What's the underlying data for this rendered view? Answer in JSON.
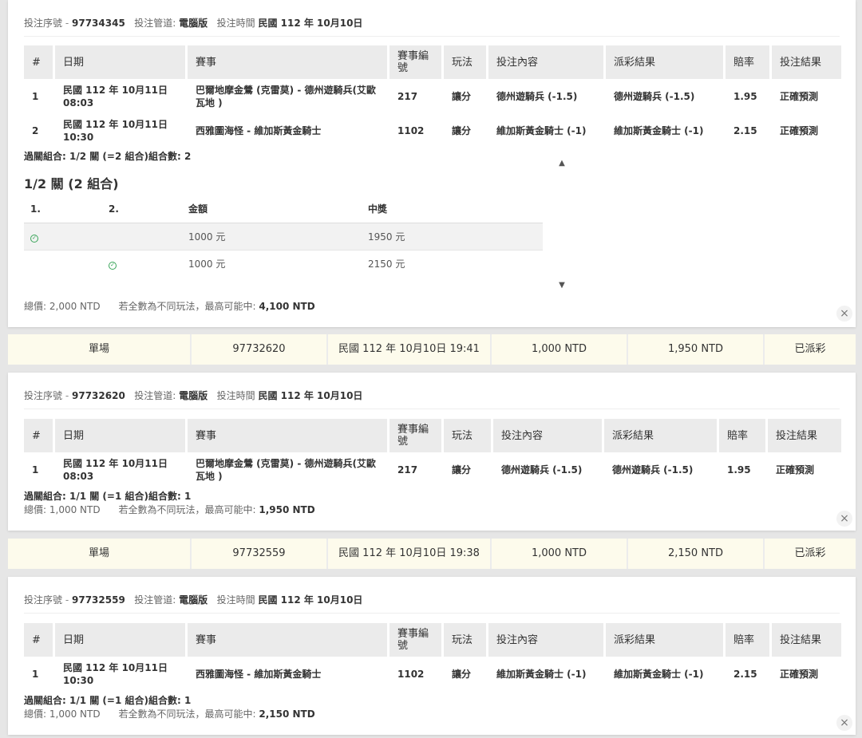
{
  "labels": {
    "serial": "投注序號",
    "channel": "投注管道:",
    "time": "投注時間",
    "total_prefix": "總價:",
    "max_prefix": "若全數為不同玩法，最高可能中:",
    "close_icon": "close-icon",
    "check_icon": "check-circle-icon",
    "scroll_up_icon": "chevron-up-icon",
    "scroll_down_icon": "chevron-down-icon"
  },
  "headers": [
    "#",
    "日期",
    "賽事",
    "賽事編號",
    "玩法",
    "投注內容",
    "派彩結果",
    "賠率",
    "投注結果"
  ],
  "bets": [
    {
      "serial": "97734345",
      "channel": "電腦版",
      "time": "民國 112 年 10月10日",
      "rows": [
        {
          "no": "1",
          "date": "民國 112 年 10月11日",
          "clock": "08:03",
          "game": "巴爾地摩金鶯 (克雷莫) - 德州遊騎兵(艾歐瓦地 )",
          "code": "217",
          "type": "讓分",
          "pick": "德州遊騎兵 (-1.5)",
          "result": "德州遊騎兵 (-1.5)",
          "odds": "1.95",
          "outcome": "正確預測"
        },
        {
          "no": "2",
          "date": "民國 112 年 10月11日",
          "clock": "10:30",
          "game": "西雅圖海怪 - 維加斯黃金騎士",
          "code": "1102",
          "type": "讓分",
          "pick": "維加斯黃金騎士 (-1)",
          "result": "維加斯黃金騎士 (-1)",
          "odds": "2.15",
          "outcome": "正確預測"
        }
      ],
      "combo": "過關組合: 1/2 關 (=2 組合)組合數: 2",
      "combo_detail": {
        "title": "1/2 關 (2 組合)",
        "headers": [
          "1.",
          "2.",
          "金額",
          "中獎"
        ],
        "rows": [
          {
            "amount": "1000 元",
            "win": "1950 元"
          },
          {
            "amount": "1000 元",
            "win": "2150 元"
          }
        ]
      },
      "total": "2,000 NTD",
      "max_win": "4,100 NTD"
    },
    {
      "serial": "97732620",
      "channel": "電腦版",
      "time": "民國 112 年 10月10日",
      "rows": [
        {
          "no": "1",
          "date": "民國 112 年 10月11日",
          "clock": "08:03",
          "game": "巴爾地摩金鶯 (克雷莫) - 德州遊騎兵(艾歐瓦地 )",
          "code": "217",
          "type": "讓分",
          "pick": "德州遊騎兵 (-1.5)",
          "result": "德州遊騎兵 (-1.5)",
          "odds": "1.95",
          "outcome": "正確預測"
        }
      ],
      "combo": "過關組合: 1/1 關 (=1 組合)組合數: 1",
      "total": "1,000 NTD",
      "max_win": "1,950 NTD"
    },
    {
      "serial": "97732559",
      "channel": "電腦版",
      "time": "民國 112 年 10月10日",
      "rows": [
        {
          "no": "1",
          "date": "民國 112 年 10月11日",
          "clock": "10:30",
          "game": "西雅圖海怪 - 維加斯黃金騎士",
          "code": "1102",
          "type": "讓分",
          "pick": "維加斯黃金騎士 (-1)",
          "result": "維加斯黃金騎士 (-1)",
          "odds": "2.15",
          "outcome": "正確預測"
        }
      ],
      "combo": "過關組合: 1/1 關 (=1 組合)組合數: 1",
      "total": "1,000 NTD",
      "max_win": "2,150 NTD"
    }
  ],
  "summaries": [
    {
      "kind": "單場",
      "serial": "97732620",
      "time": "民國 112 年 10月10日 19:41",
      "stake": "1,000 NTD",
      "payout": "1,950 NTD",
      "status": "已派彩"
    },
    {
      "kind": "單場",
      "serial": "97732559",
      "time": "民國 112 年 10月10日 19:38",
      "stake": "1,000 NTD",
      "payout": "2,150 NTD",
      "status": "已派彩"
    }
  ]
}
